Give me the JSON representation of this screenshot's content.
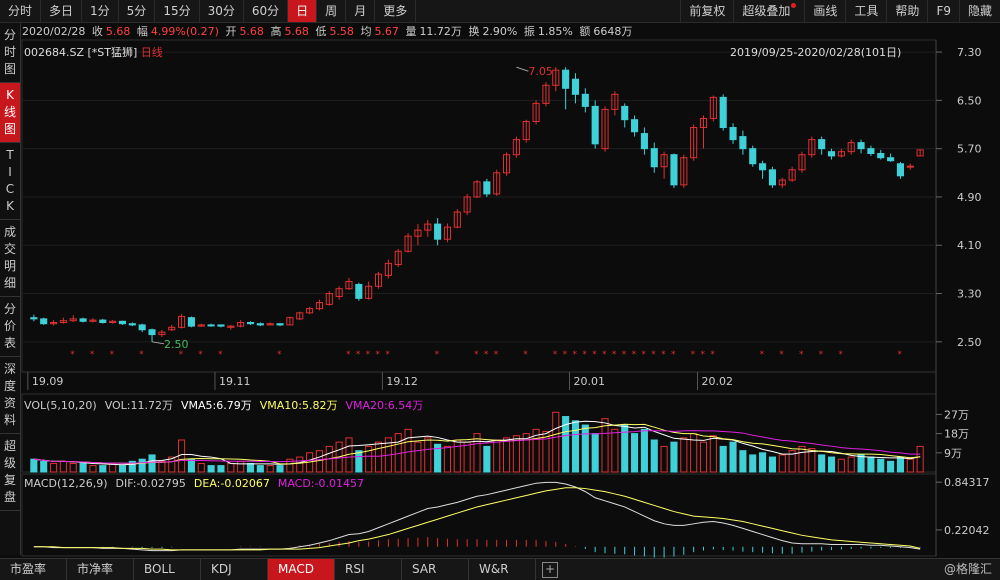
{
  "toolbar": {
    "left_items": [
      "分时",
      "多日",
      "1分",
      "5分",
      "15分",
      "30分",
      "60分",
      "日",
      "周",
      "月",
      "更多"
    ],
    "active_item": "日",
    "right_items": [
      "前复权",
      "超级叠加",
      "画线",
      "工具",
      "帮助",
      "F9",
      "隐藏"
    ]
  },
  "quote": {
    "date": "2020/02/28",
    "close_label": "收",
    "close": "5.68",
    "change_label": "幅",
    "change": "4.99%(0.27)",
    "open_label": "开",
    "open": "5.68",
    "high_label": "高",
    "high": "5.68",
    "low_label": "低",
    "low": "5.58",
    "avg_label": "均",
    "avg": "5.67",
    "volume_label": "量",
    "volume": "11.72万",
    "turnover_label": "换",
    "turnover": "2.90%",
    "amplitude_label": "振",
    "amplitude": "1.85%",
    "amount_label": "额",
    "amount": "6648万"
  },
  "chart_header": {
    "code": "002684.SZ",
    "name": "[*ST猛狮]",
    "period": "日线",
    "range": "2019/09/25-2020/02/28(101日)"
  },
  "sidebar": [
    {
      "label": "分时图",
      "active": false
    },
    {
      "label": "K线图",
      "active": true
    },
    {
      "label": "TICK",
      "active": false
    },
    {
      "label": "成交明细",
      "active": false
    },
    {
      "label": "分价表",
      "active": false
    },
    {
      "label": "深度资料",
      "active": false
    },
    {
      "label": "超级复盘",
      "active": false
    }
  ],
  "bottom_tabs": [
    "市盈率",
    "市净率",
    "BOLL",
    "KDJ",
    "MACD",
    "RSI",
    "SAR",
    "W&R"
  ],
  "active_tab": "MACD",
  "watermark": "@格隆汇",
  "colors": {
    "up": "#e03030",
    "down": "#3fd0d8",
    "vma5": "#ffffff",
    "vma10": "#ffff66",
    "vma20": "#e020e0",
    "accent": "#c8161d"
  },
  "vol_legend": {
    "params": "VOL(5,10,20)",
    "vol": "VOL:11.72万",
    "vma5": "VMA5:6.79万",
    "vma10": "VMA10:5.82万",
    "vma20": "VMA20:6.54万"
  },
  "macd_legend": {
    "params": "MACD(12,26,9)",
    "dif": "DIF:-0.02795",
    "dea": "DEA:-0.02067",
    "macd": "MACD:-0.01457"
  },
  "chart_data": {
    "type": "candlestick",
    "price_axis_ticks": [
      "7.30",
      "6.50",
      "5.70",
      "4.90",
      "4.10",
      "3.30",
      "2.50"
    ],
    "price_range": [
      2.0,
      7.5
    ],
    "x_ticks": [
      {
        "label": "19.09",
        "index": 0
      },
      {
        "label": "19.11",
        "index": 19
      },
      {
        "label": "19.12",
        "index": 36
      },
      {
        "label": "20.01",
        "index": 55
      },
      {
        "label": "20.02",
        "index": 68
      }
    ],
    "annotations": [
      {
        "label": "7.05",
        "index": 49,
        "value": 7.05
      },
      {
        "label": "2.50",
        "index": 12,
        "value": 2.5
      }
    ],
    "candles": [
      [
        2.9,
        2.88,
        2.95,
        2.84
      ],
      [
        2.88,
        2.8,
        2.9,
        2.78
      ],
      [
        2.8,
        2.82,
        2.86,
        2.77
      ],
      [
        2.82,
        2.85,
        2.9,
        2.8
      ],
      [
        2.85,
        2.88,
        2.94,
        2.83
      ],
      [
        2.88,
        2.84,
        2.9,
        2.82
      ],
      [
        2.84,
        2.86,
        2.89,
        2.82
      ],
      [
        2.86,
        2.82,
        2.88,
        2.8
      ],
      [
        2.82,
        2.84,
        2.86,
        2.8
      ],
      [
        2.84,
        2.8,
        2.85,
        2.78
      ],
      [
        2.8,
        2.78,
        2.82,
        2.76
      ],
      [
        2.78,
        2.7,
        2.8,
        2.66
      ],
      [
        2.7,
        2.62,
        2.72,
        2.5
      ],
      [
        2.62,
        2.66,
        2.7,
        2.58
      ],
      [
        2.7,
        2.74,
        2.78,
        2.68
      ],
      [
        2.74,
        2.92,
        2.96,
        2.72
      ],
      [
        2.9,
        2.76,
        2.92,
        2.74
      ],
      [
        2.76,
        2.78,
        2.8,
        2.75
      ],
      [
        2.78,
        2.77,
        2.8,
        2.75
      ],
      [
        2.78,
        2.76,
        2.79,
        2.74
      ],
      [
        2.74,
        2.76,
        2.78,
        2.7
      ],
      [
        2.76,
        2.82,
        2.86,
        2.74
      ],
      [
        2.82,
        2.8,
        2.84,
        2.78
      ],
      [
        2.8,
        2.78,
        2.82,
        2.76
      ],
      [
        2.78,
        2.8,
        2.82,
        2.77
      ],
      [
        2.8,
        2.78,
        2.81,
        2.76
      ],
      [
        2.78,
        2.9,
        2.92,
        2.78
      ],
      [
        2.88,
        2.98,
        3.0,
        2.86
      ],
      [
        2.98,
        3.05,
        3.08,
        2.96
      ],
      [
        3.05,
        3.15,
        3.2,
        3.02
      ],
      [
        3.12,
        3.3,
        3.34,
        3.1
      ],
      [
        3.25,
        3.38,
        3.42,
        3.2
      ],
      [
        3.38,
        3.5,
        3.56,
        3.36
      ],
      [
        3.45,
        3.22,
        3.48,
        3.18
      ],
      [
        3.22,
        3.42,
        3.5,
        3.2
      ],
      [
        3.42,
        3.62,
        3.66,
        3.38
      ],
      [
        3.6,
        3.8,
        3.86,
        3.55
      ],
      [
        3.78,
        4.0,
        4.04,
        3.74
      ],
      [
        4.0,
        4.25,
        4.3,
        3.98
      ],
      [
        4.25,
        4.35,
        4.45,
        4.1
      ],
      [
        4.35,
        4.45,
        4.52,
        4.24
      ],
      [
        4.45,
        4.2,
        4.55,
        4.1
      ],
      [
        4.2,
        4.4,
        4.46,
        4.15
      ],
      [
        4.4,
        4.65,
        4.7,
        4.38
      ],
      [
        4.65,
        4.9,
        4.95,
        4.6
      ],
      [
        4.9,
        5.15,
        5.18,
        4.88
      ],
      [
        5.15,
        4.95,
        5.2,
        4.9
      ],
      [
        4.95,
        5.3,
        5.35,
        4.92
      ],
      [
        5.3,
        5.6,
        5.64,
        5.25
      ],
      [
        5.6,
        5.85,
        5.9,
        5.55
      ],
      [
        5.85,
        6.15,
        6.18,
        5.8
      ],
      [
        6.15,
        6.45,
        6.5,
        6.1
      ],
      [
        6.45,
        6.75,
        6.8,
        6.4
      ],
      [
        6.75,
        7.0,
        7.05,
        6.65
      ],
      [
        7.0,
        6.7,
        7.05,
        6.35
      ],
      [
        6.85,
        6.6,
        6.95,
        6.45
      ],
      [
        6.6,
        6.4,
        6.7,
        6.3
      ],
      [
        6.4,
        5.78,
        6.5,
        5.7
      ],
      [
        5.7,
        6.35,
        6.4,
        5.65
      ],
      [
        6.35,
        6.6,
        6.65,
        6.25
      ],
      [
        6.4,
        6.18,
        6.45,
        6.05
      ],
      [
        6.18,
        5.98,
        6.25,
        5.9
      ],
      [
        5.95,
        5.7,
        6.05,
        5.6
      ],
      [
        5.7,
        5.4,
        5.8,
        5.3
      ],
      [
        5.4,
        5.6,
        5.65,
        5.2
      ],
      [
        5.6,
        5.1,
        5.62,
        5.05
      ],
      [
        5.1,
        5.55,
        5.6,
        5.05
      ],
      [
        5.55,
        6.05,
        6.1,
        5.5
      ],
      [
        6.05,
        6.2,
        6.25,
        5.7
      ],
      [
        6.2,
        6.55,
        6.58,
        6.15
      ],
      [
        6.55,
        6.05,
        6.6,
        6.0
      ],
      [
        6.05,
        5.85,
        6.12,
        5.78
      ],
      [
        5.9,
        5.7,
        6.0,
        5.6
      ],
      [
        5.7,
        5.45,
        5.75,
        5.4
      ],
      [
        5.45,
        5.35,
        5.5,
        5.2
      ],
      [
        5.35,
        5.1,
        5.4,
        5.05
      ],
      [
        5.1,
        5.18,
        5.22,
        5.05
      ],
      [
        5.18,
        5.35,
        5.4,
        5.15
      ],
      [
        5.35,
        5.6,
        5.65,
        5.3
      ],
      [
        5.6,
        5.85,
        5.9,
        5.55
      ],
      [
        5.85,
        5.7,
        5.9,
        5.6
      ],
      [
        5.65,
        5.58,
        5.7,
        5.52
      ],
      [
        5.58,
        5.65,
        5.7,
        5.55
      ],
      [
        5.65,
        5.8,
        5.85,
        5.6
      ],
      [
        5.8,
        5.7,
        5.85,
        5.62
      ],
      [
        5.7,
        5.62,
        5.75,
        5.58
      ],
      [
        5.62,
        5.55,
        5.68,
        5.52
      ],
      [
        5.55,
        5.5,
        5.62,
        5.48
      ],
      [
        5.45,
        5.25,
        5.48,
        5.2
      ],
      [
        5.4,
        5.41,
        5.45,
        5.35
      ],
      [
        5.58,
        5.68,
        5.68,
        5.58
      ]
    ],
    "volumes_wan": [
      6,
      5,
      4,
      5,
      4,
      4,
      3,
      3,
      4,
      3,
      5,
      6,
      8,
      5,
      7,
      15,
      6,
      4,
      3,
      3,
      4,
      5,
      4,
      3,
      3,
      3,
      6,
      7,
      9,
      10,
      12,
      14,
      16,
      10,
      12,
      14,
      16,
      18,
      20,
      14,
      16,
      13,
      12,
      15,
      14,
      18,
      12,
      15,
      16,
      17,
      18,
      20,
      19,
      28,
      26,
      24,
      22,
      18,
      25,
      20,
      22,
      18,
      20,
      15,
      12,
      14,
      16,
      18,
      14,
      17,
      12,
      14,
      10,
      8,
      9,
      7,
      8,
      10,
      12,
      11,
      8,
      7,
      6,
      7,
      8,
      7,
      6,
      5,
      7,
      6,
      12
    ],
    "vol_axis_ticks": [
      "27万",
      "18万",
      "9万"
    ],
    "vol_max": 30,
    "macd_axis_ticks": [
      "0.84317",
      "0.22042"
    ],
    "macd_range": [
      -0.12,
      0.95
    ],
    "dif": [
      0.0,
      0.0,
      -0.01,
      -0.01,
      -0.01,
      -0.01,
      -0.01,
      -0.02,
      -0.02,
      -0.02,
      -0.03,
      -0.04,
      -0.05,
      -0.05,
      -0.05,
      -0.04,
      -0.04,
      -0.04,
      -0.04,
      -0.04,
      -0.04,
      -0.03,
      -0.03,
      -0.03,
      -0.03,
      -0.03,
      -0.02,
      0.0,
      0.02,
      0.05,
      0.08,
      0.12,
      0.16,
      0.17,
      0.2,
      0.25,
      0.3,
      0.35,
      0.4,
      0.45,
      0.5,
      0.52,
      0.55,
      0.58,
      0.62,
      0.66,
      0.68,
      0.71,
      0.74,
      0.77,
      0.8,
      0.83,
      0.84,
      0.84,
      0.82,
      0.78,
      0.72,
      0.64,
      0.6,
      0.56,
      0.52,
      0.46,
      0.4,
      0.34,
      0.3,
      0.28,
      0.28,
      0.3,
      0.32,
      0.33,
      0.31,
      0.28,
      0.24,
      0.2,
      0.16,
      0.12,
      0.08,
      0.05,
      0.04,
      0.04,
      0.04,
      0.03,
      0.03,
      0.03,
      0.03,
      0.02,
      0.02,
      0.01,
      0.0,
      -0.01,
      -0.03
    ],
    "dea": [
      0.0,
      0.0,
      0.0,
      -0.01,
      -0.01,
      -0.01,
      -0.01,
      -0.01,
      -0.01,
      -0.02,
      -0.02,
      -0.02,
      -0.03,
      -0.03,
      -0.04,
      -0.04,
      -0.04,
      -0.04,
      -0.04,
      -0.04,
      -0.04,
      -0.04,
      -0.04,
      -0.04,
      -0.03,
      -0.03,
      -0.03,
      -0.03,
      -0.02,
      -0.01,
      0.01,
      0.03,
      0.05,
      0.08,
      0.1,
      0.13,
      0.16,
      0.2,
      0.24,
      0.28,
      0.32,
      0.36,
      0.4,
      0.44,
      0.48,
      0.52,
      0.55,
      0.58,
      0.61,
      0.64,
      0.67,
      0.7,
      0.73,
      0.75,
      0.77,
      0.77,
      0.76,
      0.74,
      0.72,
      0.69,
      0.66,
      0.62,
      0.58,
      0.54,
      0.5,
      0.46,
      0.43,
      0.4,
      0.39,
      0.38,
      0.37,
      0.35,
      0.33,
      0.3,
      0.27,
      0.24,
      0.21,
      0.18,
      0.15,
      0.13,
      0.11,
      0.09,
      0.08,
      0.07,
      0.06,
      0.05,
      0.04,
      0.03,
      0.02,
      0.01,
      -0.02
    ],
    "macd_hist": [
      0.0,
      0.0,
      -0.01,
      0.0,
      0.0,
      0.0,
      0.0,
      -0.01,
      -0.01,
      0.0,
      -0.02,
      -0.04,
      -0.04,
      -0.04,
      -0.02,
      0.0,
      0.0,
      0.0,
      0.0,
      0.0,
      0.0,
      0.02,
      0.02,
      0.02,
      0.0,
      0.0,
      0.02,
      0.06,
      0.08,
      0.12,
      0.14,
      0.18,
      0.22,
      0.18,
      0.2,
      0.24,
      0.28,
      0.3,
      0.32,
      0.34,
      0.36,
      0.32,
      0.3,
      0.28,
      0.28,
      0.28,
      0.26,
      0.26,
      0.26,
      0.26,
      0.26,
      0.26,
      0.22,
      0.18,
      0.1,
      0.02,
      -0.08,
      -0.2,
      -0.24,
      -0.26,
      -0.28,
      -0.32,
      -0.36,
      -0.4,
      -0.4,
      -0.36,
      -0.3,
      -0.2,
      -0.14,
      -0.1,
      -0.12,
      -0.14,
      -0.18,
      -0.2,
      -0.22,
      -0.24,
      -0.26,
      -0.26,
      -0.22,
      -0.18,
      -0.14,
      -0.12,
      -0.1,
      -0.08,
      -0.06,
      -0.06,
      -0.04,
      -0.04,
      -0.04,
      -0.04,
      -0.02
    ]
  }
}
